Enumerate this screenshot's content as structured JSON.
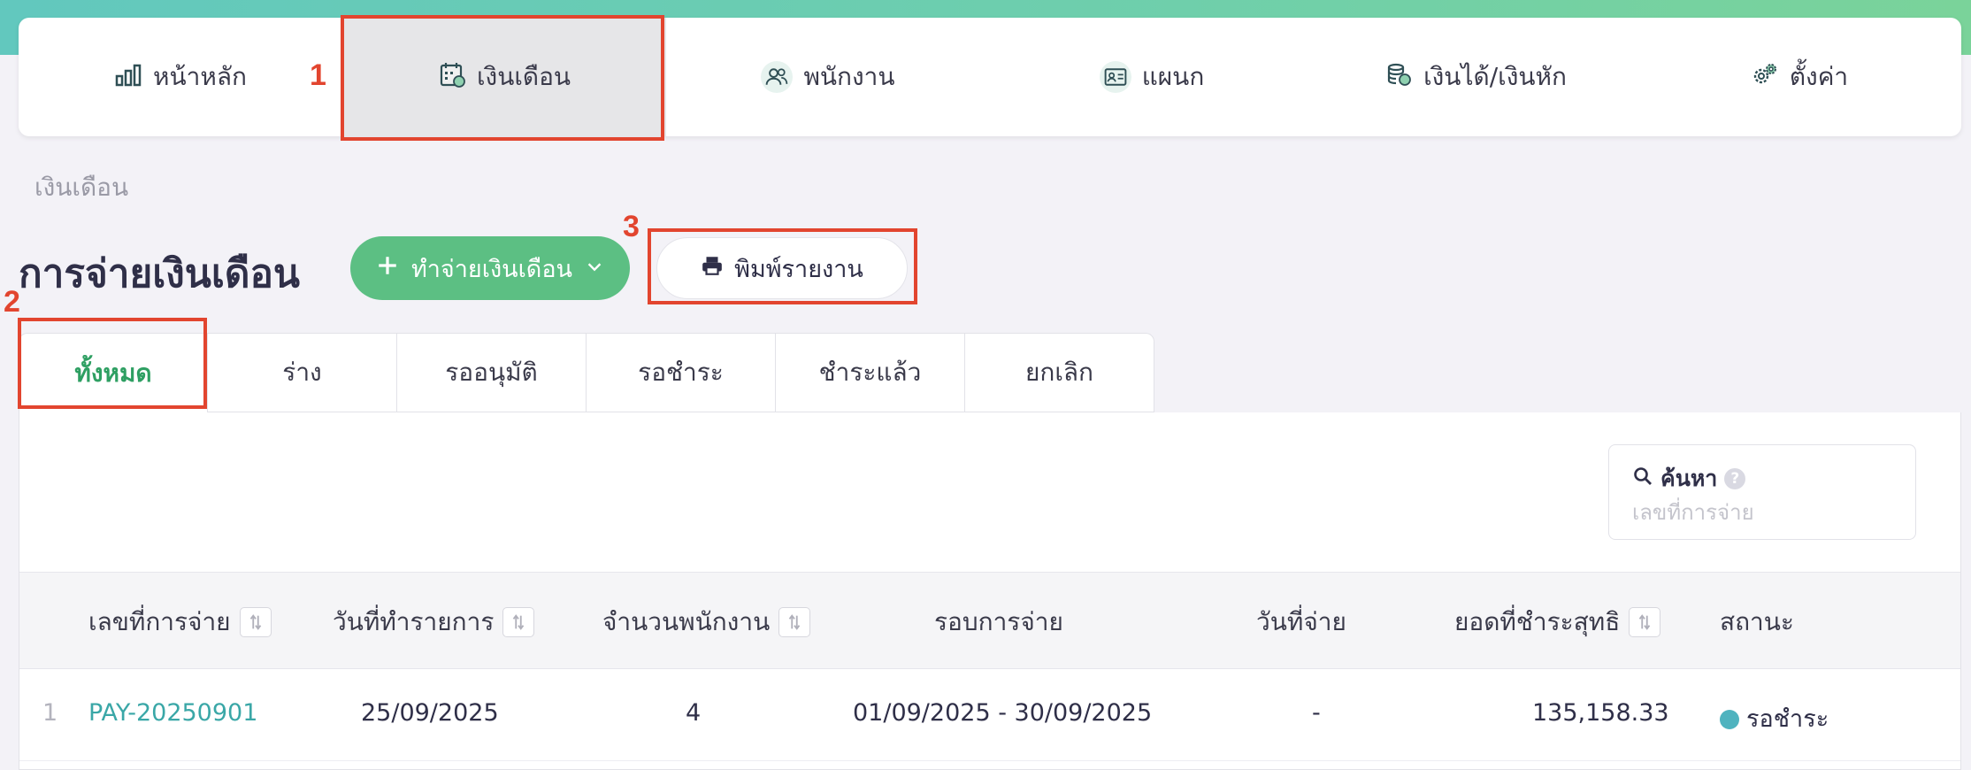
{
  "nav": {
    "items": [
      {
        "label": "หน้าหลัก",
        "icon": "bar-chart-icon",
        "active": false
      },
      {
        "label": "เงินเดือน",
        "icon": "calendar-money-icon",
        "active": true
      },
      {
        "label": "พนักงาน",
        "icon": "users-icon",
        "active": false
      },
      {
        "label": "แผนก",
        "icon": "id-card-icon",
        "active": false
      },
      {
        "label": "เงินได้/เงินหัก",
        "icon": "coins-icon",
        "active": false
      },
      {
        "label": "ตั้งค่า",
        "icon": "gears-icon",
        "active": false
      }
    ]
  },
  "annotations": [
    "1",
    "2",
    "3"
  ],
  "breadcrumb": "เงินเดือน",
  "page_title": "การจ่ายเงินเดือน",
  "actions": {
    "create_label": "ทำจ่ายเงินเดือน",
    "print_label": "พิมพ์รายงาน"
  },
  "tabs": [
    "ทั้งหมด",
    "ร่าง",
    "รออนุมัติ",
    "รอชำระ",
    "ชำระแล้ว",
    "ยกเลิก"
  ],
  "search": {
    "label": "ค้นหา",
    "help": "?",
    "placeholder": "เลขที่การจ่าย"
  },
  "table": {
    "columns": [
      "เลขที่การจ่าย",
      "วันที่ทำรายการ",
      "จำนวนพนักงาน",
      "รอบการจ่าย",
      "วันที่จ่าย",
      "ยอดที่ชำระสุทธิ",
      "สถานะ"
    ],
    "rows": [
      {
        "index": "1",
        "payment_no": "PAY-20250901",
        "created_date": "25/09/2025",
        "employee_count": "4",
        "pay_period": "01/09/2025 - 30/09/2025",
        "pay_date": "-",
        "net_amount": "135,158.33",
        "status": "รอชำระ"
      }
    ]
  },
  "colors": {
    "accent_green": "#5cbf83",
    "annotation_red": "#e2452f",
    "link_teal": "#3aa7a7",
    "status_teal": "#4fb3bf"
  }
}
